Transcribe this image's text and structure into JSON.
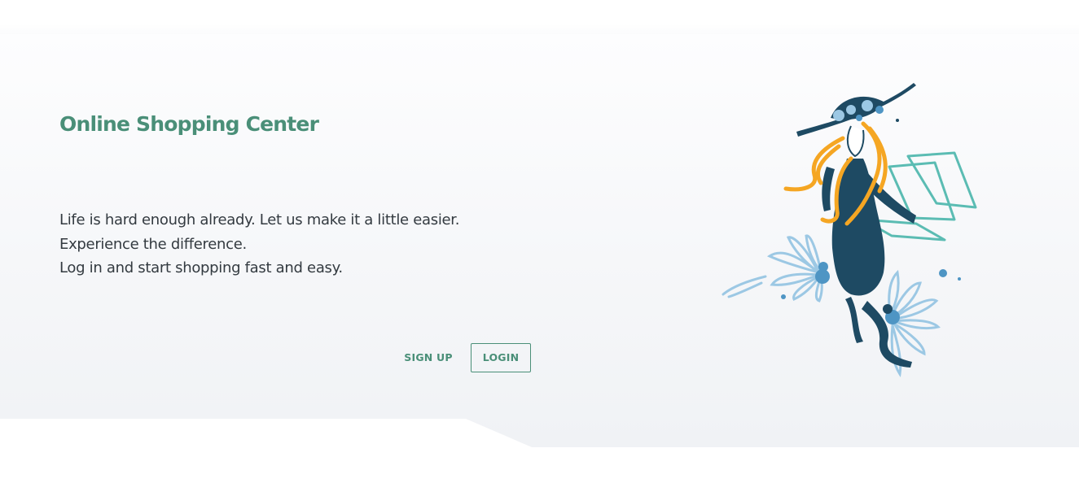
{
  "hero": {
    "title": "Online Shopping Center",
    "tagline_lines": [
      "Life is hard enough already. Let us make it a little easier.",
      "Experience the difference.",
      "Log in and start shopping fast and easy."
    ],
    "signup_label": "SIGN UP",
    "login_label": "LOGIN",
    "illustration_icon": "shopping-woman-illustration"
  },
  "colors": {
    "accent": "#4a8f78",
    "text": "#333a40",
    "navy": "#1e4a63",
    "orange": "#f5a623",
    "teal": "#5bbcb3",
    "light_blue": "#9cc8e4"
  }
}
